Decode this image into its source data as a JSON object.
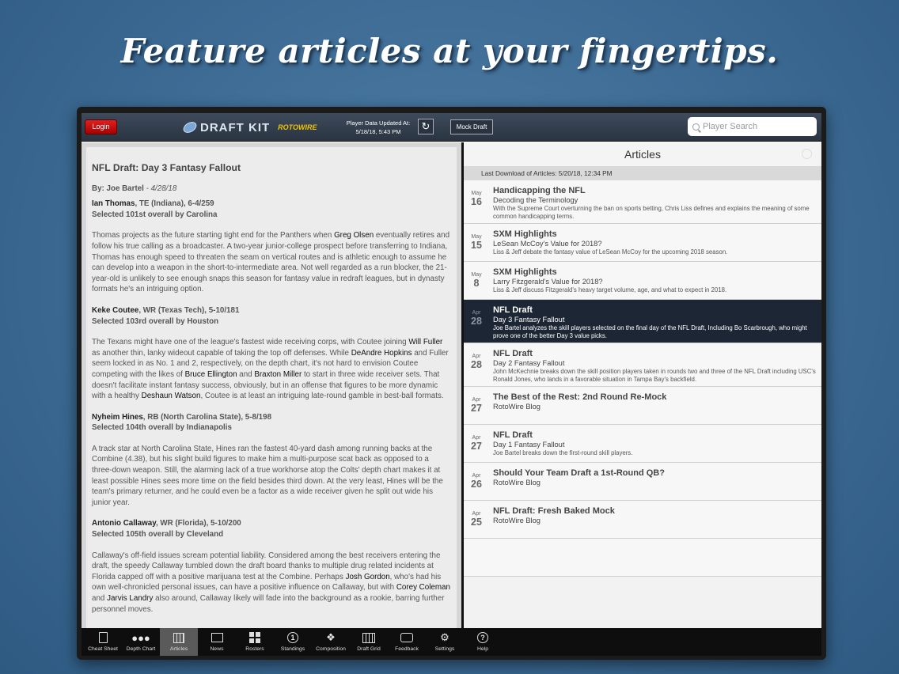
{
  "headline": "Feature articles at your fingertips.",
  "header": {
    "login_label": "Login",
    "logo_text": "DRAFT KIT",
    "logo_brand": "ROTOWIRE",
    "updated_label": "Player Data Updated At:",
    "updated_value": "5/18/18, 5:43 PM",
    "mock_draft_label": "Mock Draft",
    "search_placeholder": "Player Search"
  },
  "article": {
    "title": "NFL Draft: Day 3 Fantasy Fallout",
    "by_label": "By: Joe Bartel",
    "by_date": " - 4/28/18",
    "players": [
      {
        "name": "Ian Thomas",
        "pos": ", TE (Indiana), 6-4/259",
        "selected": "Selected 101st overall by Carolina",
        "text": [
          "Thomas projects as the future starting tight end for the Panthers when ",
          "Greg Olsen",
          " eventually retires and follow his true calling as a broadcaster. A two-year junior-college prospect before transferring to Indiana, Thomas has enough speed to threaten the seam on vertical routes and is athletic enough to assume he can develop into a weapon in the short-to-intermediate area. Not well regarded as a run blocker, the 21-year-old is unlikely to see enough snaps this season for fantasy value in redraft leagues, but in dynasty formats he's an intriguing option."
        ]
      },
      {
        "name": "Keke Coutee",
        "pos": ", WR (Texas Tech), 5-10/181",
        "selected": "Selected 103rd overall by Houston",
        "text": [
          "The Texans might have one of the league's fastest wide receiving corps, with Coutee joining ",
          "Will Fuller",
          " as another thin, lanky wideout capable of taking the top off defenses. While ",
          "DeAndre Hopkins",
          " and Fuller seem locked in as No. 1 and 2, respectively, on the depth chart, it's not hard to envision Coutee competing with the likes of ",
          "Bruce Ellington",
          " and ",
          "Braxton Miller",
          " to start in three wide receiver sets. That doesn't facilitate instant fantasy success, obviously, but in an offense that figures to be more dynamic with a healthy ",
          "Deshaun Watson",
          ", Coutee is at least an intriguing late-round gamble in best-ball formats."
        ]
      },
      {
        "name": "Nyheim Hines",
        "pos": ", RB (North Carolina State), 5-8/198",
        "selected": "Selected 104th overall by Indianapolis",
        "text": [
          "A track star at North Carolina State, Hines ran the fastest 40-yard dash among running backs at the Combine (4.38), but his slight build figures to make him a multi-purpose scat back as opposed to a three-down weapon. Still, the alarming lack of a true workhorse atop the Colts' depth chart makes it at least possible Hines sees more time on the field besides third down. At the very least, Hines will be the team's primary returner, and he could even be a factor as a wide receiver given he split out wide his junior year."
        ]
      },
      {
        "name": "Antonio Callaway",
        "pos": ", WR (Florida), 5-10/200",
        "selected": "Selected 105th overall by Cleveland",
        "text": [
          "Callaway's off-field issues scream potential liability. Considered among the best receivers entering the draft, the speedy Callaway tumbled down the draft board thanks to multiple drug related incidents at Florida capped off with a positive marijuana test at the Combine. Perhaps ",
          "Josh Gordon",
          ", who's had his own well-chronicled personal issues, can have a positive influence on Callaway, but with ",
          "Corey Coleman",
          " and ",
          "Jarvis Landry",
          " also around, Callaway likely will fade into the background as a rookie, barring further personnel moves."
        ]
      }
    ]
  },
  "articles_panel": {
    "title": "Articles",
    "last_download": "Last Download of Articles: 5/20/18, 12:34 PM",
    "items": [
      {
        "month": "May",
        "day": "16",
        "title": "Handicapping the NFL",
        "subtitle": "Decoding the Terminology",
        "desc": "With the Supreme Court overturning the ban on sports betting, Chris Liss defines and explains the meaning of some common handicapping terms."
      },
      {
        "month": "May",
        "day": "15",
        "title": "SXM Highlights",
        "subtitle": "LeSean McCoy's Value for 2018?",
        "desc": "Liss & Jeff debate the fantasy value of LeSean McCoy for the upcoming 2018 season."
      },
      {
        "month": "May",
        "day": "8",
        "title": "SXM Highlights",
        "subtitle": "Larry Fitzgerald's Value for 2018?",
        "desc": "Liss & Jeff discuss Fitzgerald's heavy target volume, age, and what to expect in 2018."
      },
      {
        "month": "Apr",
        "day": "28",
        "title": "NFL Draft",
        "subtitle": "Day 3 Fantasy Fallout",
        "desc": "Joe Bartel analyzes the skill players selected on the final day of the NFL Draft, Including Bo Scarbrough, who might prove one of the better Day 3 value picks."
      },
      {
        "month": "Apr",
        "day": "28",
        "title": "NFL Draft",
        "subtitle": "Day 2 Fantasy Fallout",
        "desc": "John McKechnie breaks down the skill position players taken in rounds two and three of the NFL Draft including USC's Ronald Jones, who lands in a favorable situation in Tampa Bay's backfield."
      },
      {
        "month": "Apr",
        "day": "27",
        "title": "The Best of the Rest: 2nd Round Re-Mock",
        "subtitle": "RotoWire Blog",
        "desc": ""
      },
      {
        "month": "Apr",
        "day": "27",
        "title": "NFL Draft",
        "subtitle": "Day 1 Fantasy Fallout",
        "desc": "Joe Bartel breaks down the first-round skill players."
      },
      {
        "month": "Apr",
        "day": "26",
        "title": "Should Your Team Draft a 1st-Round QB?",
        "subtitle": "RotoWire Blog",
        "desc": ""
      },
      {
        "month": "Apr",
        "day": "25",
        "title": "NFL Draft: Fresh Baked Mock",
        "subtitle": "RotoWire Blog",
        "desc": ""
      }
    ]
  },
  "tabs": [
    {
      "label": "Cheat Sheet",
      "icon": "cheat-sheet-icon"
    },
    {
      "label": "Depth Chart",
      "icon": "depth-chart-icon"
    },
    {
      "label": "Articles",
      "icon": "articles-icon"
    },
    {
      "label": "News",
      "icon": "news-icon"
    },
    {
      "label": "Rosters",
      "icon": "rosters-icon"
    },
    {
      "label": "Standings",
      "icon": "standings-icon"
    },
    {
      "label": "Composition",
      "icon": "composition-icon"
    },
    {
      "label": "Draft Grid",
      "icon": "draft-grid-icon"
    },
    {
      "label": "Feedback",
      "icon": "feedback-icon"
    },
    {
      "label": "Settings",
      "icon": "settings-icon"
    },
    {
      "label": "Help",
      "icon": "help-icon"
    }
  ],
  "colors": {
    "accent": "#1c2634",
    "login": "#c80000",
    "background": "#3c6a93"
  }
}
